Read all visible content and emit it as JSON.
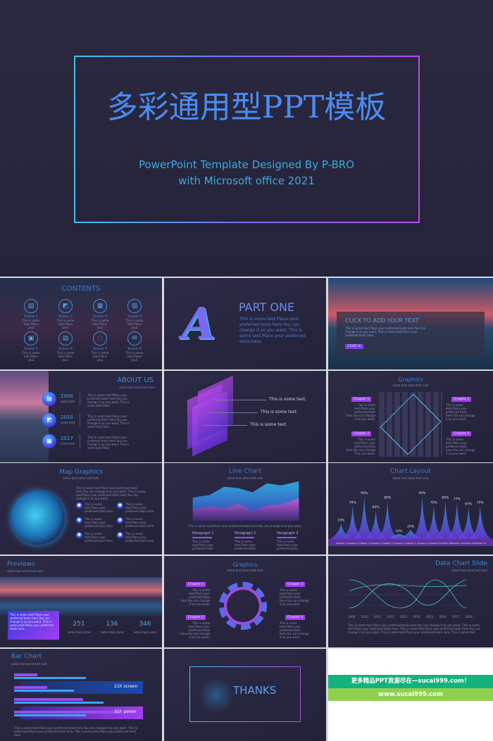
{
  "cover": {
    "title": "多彩通用型PPT模板",
    "subtitle_line1": "PowerPoint Template Designed By P-BRO",
    "subtitle_line2": "with Microsoft office 2021"
  },
  "contents": {
    "title": "CONTENTS",
    "scenes": [
      "Scene 1",
      "Scene 2",
      "Scene 3",
      "Scene 4",
      "Scene 5",
      "Scene 6",
      "Scene 7",
      "Scene 8"
    ],
    "scene_desc": "This is some text Place your"
  },
  "part_one": {
    "title": "PART ONE",
    "body": "This is some text.Place your preferred texts here.You can change it as you want. This is some text.Place your preferred texts here."
  },
  "cta": {
    "title": "CLICK TO ADD YOUR TEXT",
    "body": "This is some text.Place your preferred texts here.You can change it as you want. This is some text.Place your preferred texts here.",
    "button": "START IV"
  },
  "about": {
    "title": "ABOUT US",
    "subtitle": "some text some text som",
    "items": [
      {
        "year": "2008",
        "label": "some text"
      },
      {
        "year": "2010",
        "label": "some text"
      },
      {
        "year": "2017",
        "label": "some text"
      }
    ],
    "item_body": "This is some text.Place your preferred texts here.You can change it as you want. This is some text.Place"
  },
  "layers": {
    "lines": [
      "This is some text.",
      "This is some text.",
      "This is some text."
    ]
  },
  "graphics1": {
    "title": "Graphics",
    "subtitle": "some text some text som",
    "chapters": [
      "Chapter 1",
      "Chapter 2",
      "Chapter 3",
      "Chapter 4"
    ],
    "chapter_body": "This is some text.Place your preferred texts here.You can change it as you want."
  },
  "map": {
    "title": "Map Graphics",
    "subtitle": "some text some text som",
    "intro": "This is some text.Place your preferred texts here.You can change it as you want. This is some text.Place your preferred texts here.You can change it as you want.",
    "item_body": "This is some text.Place your preferred texts here"
  },
  "linechart": {
    "title": "Line Chart",
    "subtitle": "some text some text som",
    "caption": "This is some text.Place your preferred texts here.You can change it as you want.",
    "paragraphs": [
      "Paragraph 1",
      "Paragraph 2",
      "Paragraph 3"
    ],
    "para_body": "This is some text.Place your preferred texts"
  },
  "chartlayout": {
    "title": "Chart Layout",
    "subtitle": "some text some text som",
    "values": [
      33,
      70,
      90,
      60,
      80,
      10,
      20,
      90,
      70,
      80,
      77,
      67,
      70
    ],
    "labels": [
      "Chapter 1",
      "Chapter 2",
      "Chapter 3",
      "Chapter 4",
      "Chapter 5",
      "Chapter 6",
      "Chapter 7",
      "Chapter 8",
      "Chapter 9",
      "Chapter 10",
      "Chapter 11",
      "Chapter 12",
      "Chapter 13"
    ],
    "unit": "%"
  },
  "previews": {
    "title": "Previews",
    "subtitle": "some text some text som",
    "box": "This is some text.Place your preferred texts here.You can change it as you want. This is some text.Place your preferred texts here.",
    "stats": [
      {
        "value": "251",
        "label": "some text some"
      },
      {
        "value": "136",
        "label": "some text some"
      },
      {
        "value": "346",
        "label": "some text some"
      }
    ]
  },
  "graphics2": {
    "title": "Graphics",
    "subtitle": "some text some text som",
    "chapters": [
      "Chapter 1",
      "Chapter 2",
      "Chapter 3",
      "Chapter 4"
    ],
    "chapter_body": "This is some text.Place your preferred texts here.You can change it as you want."
  },
  "datachart": {
    "title": "Data Chart Slide",
    "subtitle": "some text some text som",
    "years": [
      "2009",
      "2010",
      "2011",
      "2012",
      "2013",
      "2014",
      "2015",
      "2016",
      "2017",
      "2018"
    ],
    "body": "This is some text.Place your preferred texts here.You can change it as you want. This is some text.Place your preferred texts here. This is some text.Place your preferred texts here.You can change it as you want. This is some text.Place your preferred texts here. This is some text."
  },
  "barchart": {
    "title": "Bar Chart",
    "subtitle": "some text some text som",
    "tags": [
      {
        "value": "21h",
        "label": "screen"
      },
      {
        "value": "31h",
        "label": "power"
      }
    ],
    "body": "This is some text.Place your preferred texts here.You can change it as you want. This is some text.Place your preferred texts here. This is some text.Place your preferred texts here."
  },
  "thanks": {
    "title": "THANKS"
  },
  "ad": {
    "line1": "更多精品PPT资源尽在—sucai999.com！",
    "line2": "www.sucai999.com",
    "green": "#14b27f",
    "lime": "#8fd14f"
  }
}
